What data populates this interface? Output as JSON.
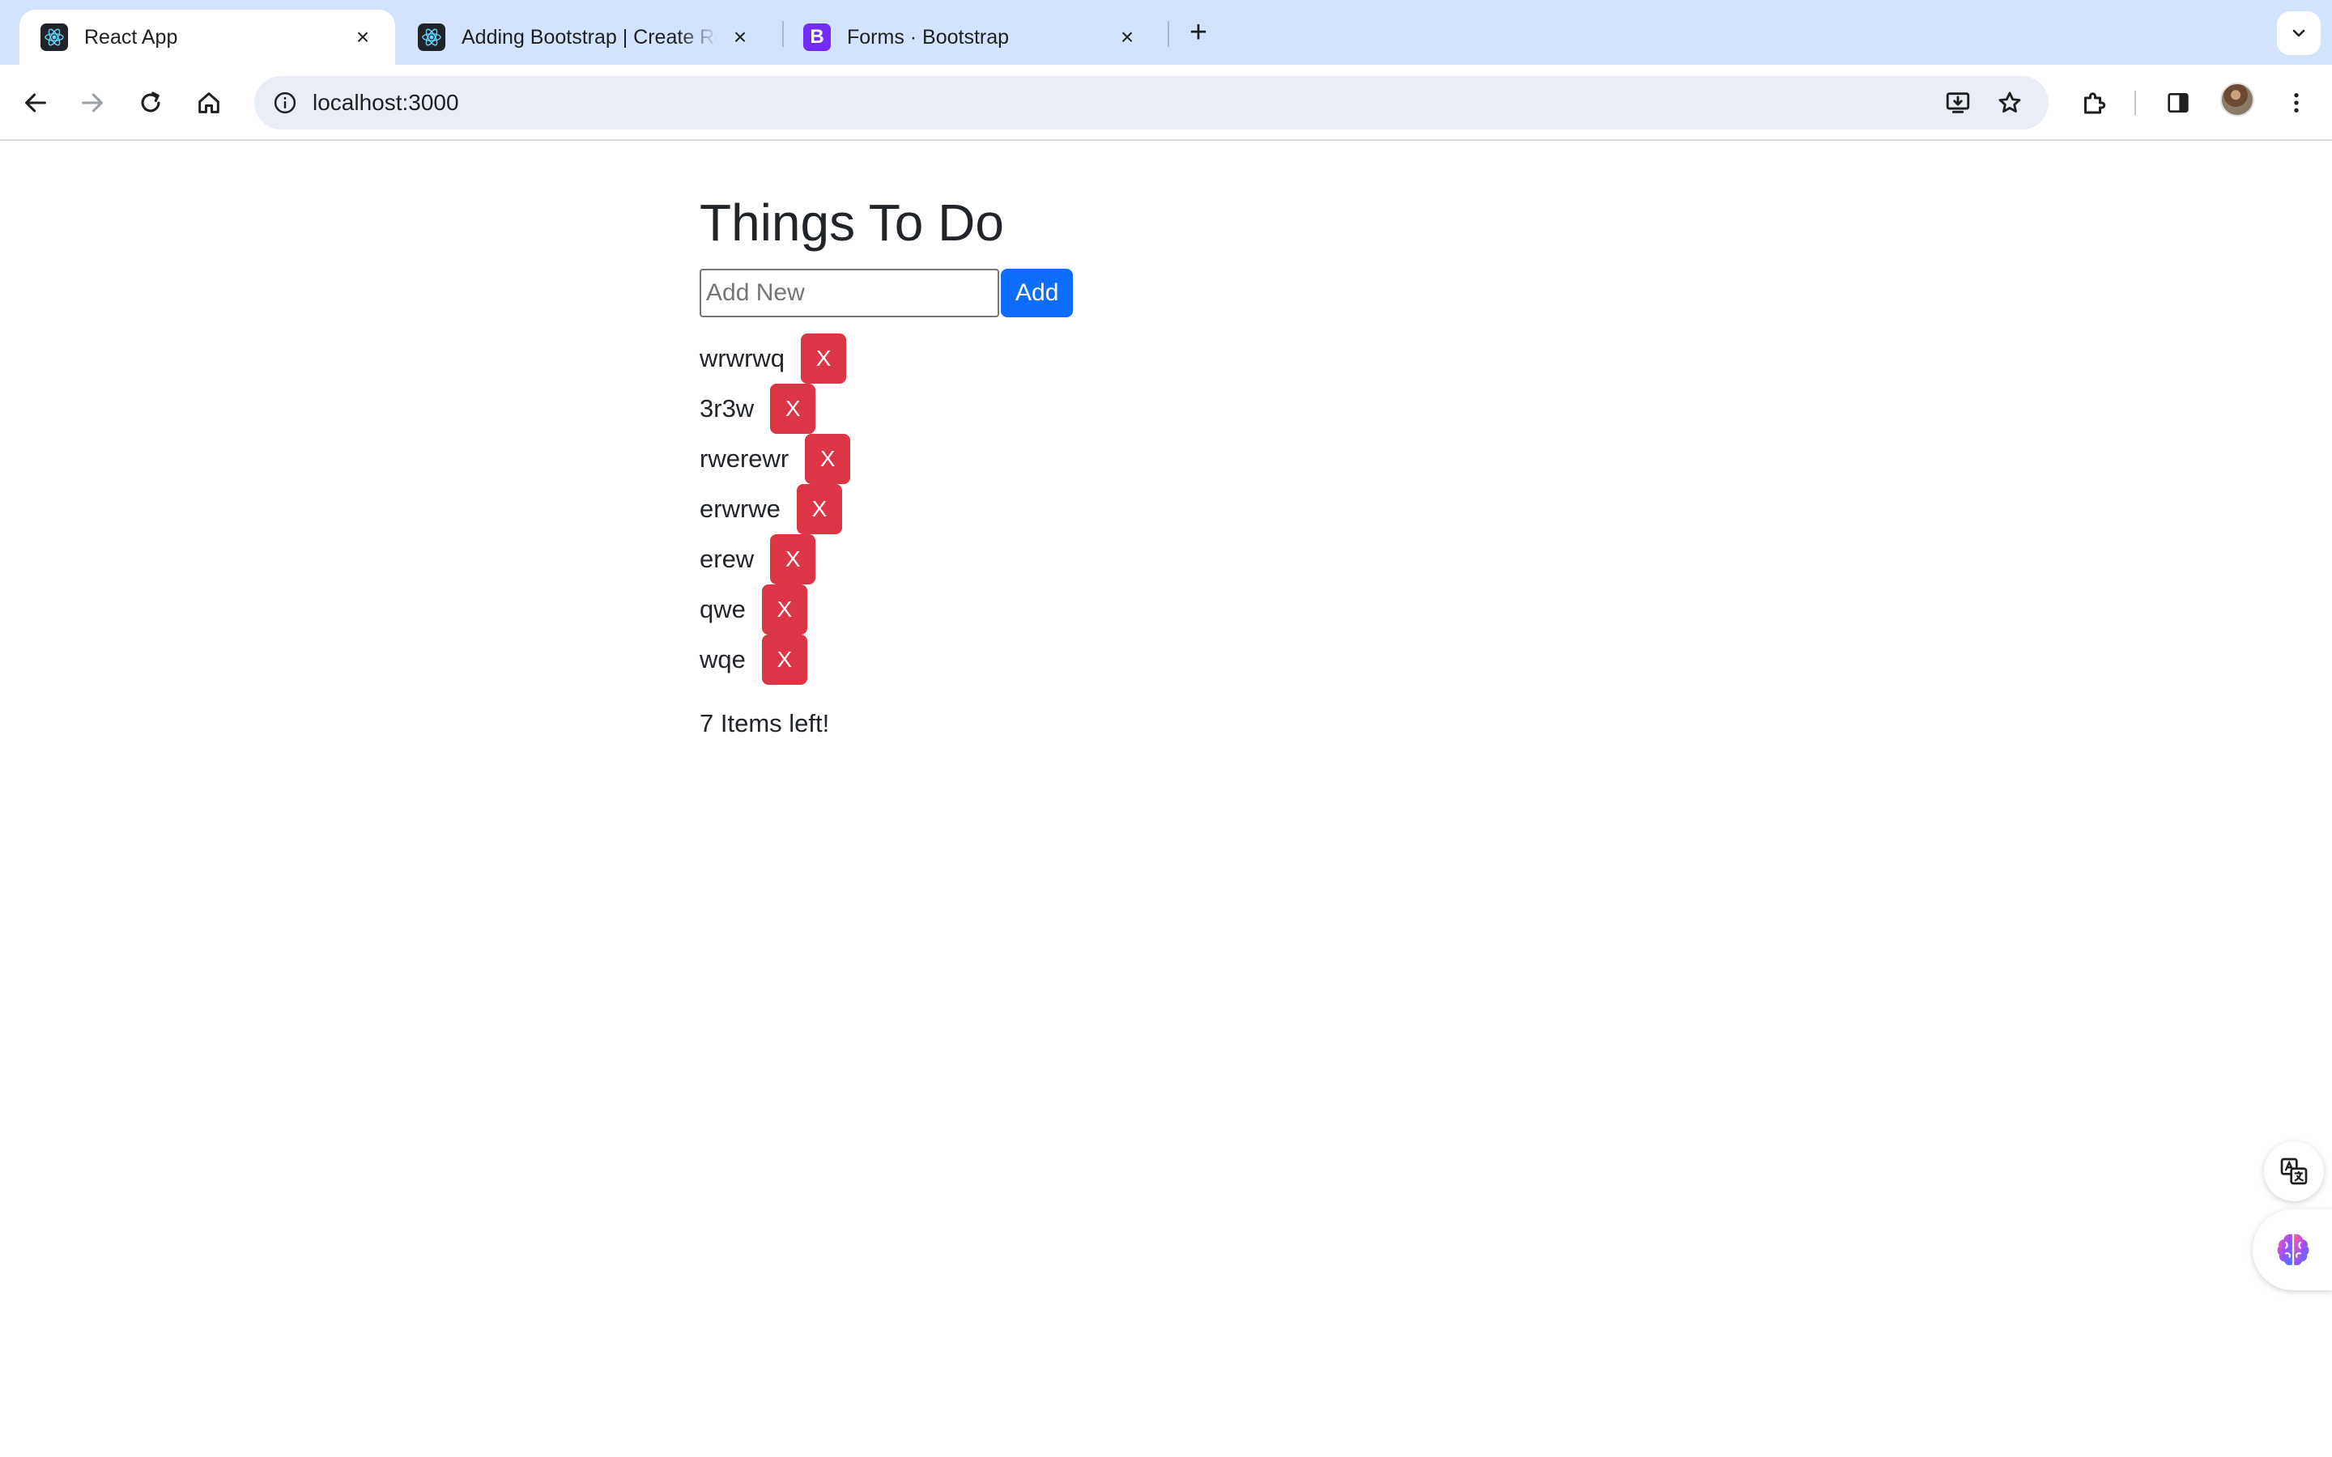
{
  "browser": {
    "tabs": [
      {
        "title": "React App",
        "favicon": "react-icon",
        "active": true
      },
      {
        "title": "Adding Bootstrap | Create React App",
        "favicon": "react-icon",
        "active": false
      },
      {
        "title": "Forms · Bootstrap",
        "favicon": "bootstrap-icon",
        "favicon_letter": "B",
        "active": false
      }
    ],
    "new_tab_label": "+",
    "url": "localhost:3000"
  },
  "app": {
    "title": "Things To Do",
    "input_placeholder": "Add New",
    "add_label": "Add",
    "delete_label": "X",
    "todos": [
      "wrwrwq",
      "3r3w",
      "rwerewr",
      "erwrwe",
      "erew",
      "qwe",
      "wqe"
    ],
    "items_left": "7 Items left!"
  },
  "colors": {
    "tab_strip": "#d3e3fd",
    "primary": "#0d6efd",
    "danger": "#dc3545",
    "omnibox": "#e9eef6"
  }
}
